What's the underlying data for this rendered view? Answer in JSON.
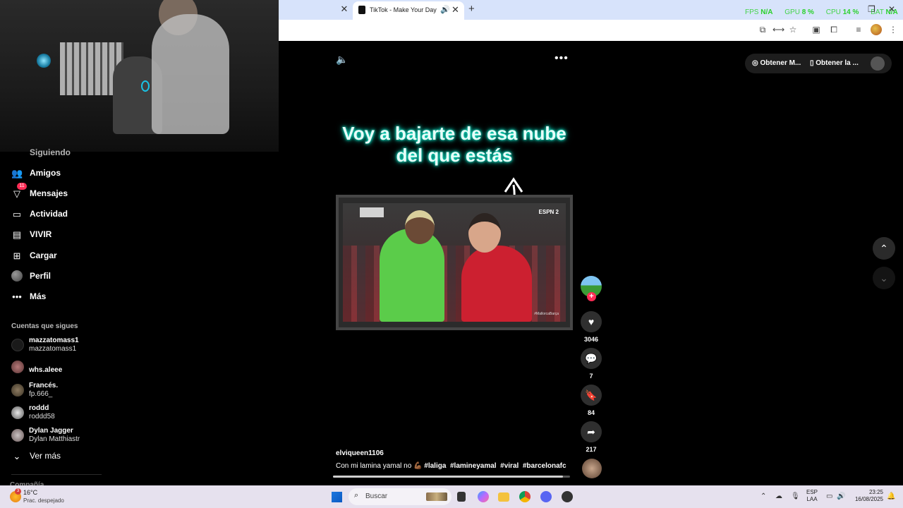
{
  "browser": {
    "tab_title": "TikTok - Make Your Day",
    "stats": {
      "fps_label": "FPS",
      "fps_value": "N/A",
      "gpu_label": "GPU",
      "gpu_value": "8 %",
      "cpu_label": "CPU",
      "cpu_value": "14 %",
      "bat_label": "BAT",
      "bat_value": "N/A"
    }
  },
  "sidebar": {
    "cut_item": "Siguiendo",
    "items": [
      {
        "label": "Amigos",
        "icon": "friends-icon"
      },
      {
        "label": "Mensajes",
        "icon": "messages-icon",
        "badge": "11"
      },
      {
        "label": "Actividad",
        "icon": "activity-icon"
      },
      {
        "label": "VIVIR",
        "icon": "live-icon"
      },
      {
        "label": "Cargar",
        "icon": "upload-icon"
      },
      {
        "label": "Perfil",
        "icon": "avatar"
      },
      {
        "label": "Más",
        "icon": "more-icon"
      }
    ],
    "following_header": "Cuentas que sigues",
    "accounts": [
      {
        "name": "mazzatomass1",
        "handle": "mazzatomass1"
      },
      {
        "name": "whs.aleee",
        "handle": ""
      },
      {
        "name": "Francés.",
        "handle": "fp.666_"
      },
      {
        "name": "roddd",
        "handle": "roddd58"
      },
      {
        "name": "Dylan Jagger",
        "handle": "Dylan Matthiastr"
      }
    ],
    "see_more": "Ver más",
    "cut_footer": "Compañía"
  },
  "video": {
    "caption": "Voy a bajarte de esa nube del que estás",
    "tv_logo": "ESPN 2",
    "tv_watermark": "#MallorcaBarça",
    "username": "elviqueen1106",
    "description_text": "Con mi lamina yamal no 💪🏾",
    "hashtags": [
      "#laliga",
      "#lamineyamal",
      "#viral",
      "#barcelonafc"
    ],
    "progress": 0.97
  },
  "actions": {
    "likes": "3046",
    "comments": "7",
    "saves": "84",
    "shares": "217"
  },
  "topbar": {
    "pill1": "Obtener M...",
    "pill2": "Obtener la ..."
  },
  "taskbar": {
    "weather_badge": "3",
    "temperature": "16°C",
    "weather_desc": "Prac. despejado",
    "search_placeholder": "Buscar",
    "lang1": "ESP",
    "lang2": "LAA",
    "time": "23:25",
    "date": "16/08/2025"
  }
}
